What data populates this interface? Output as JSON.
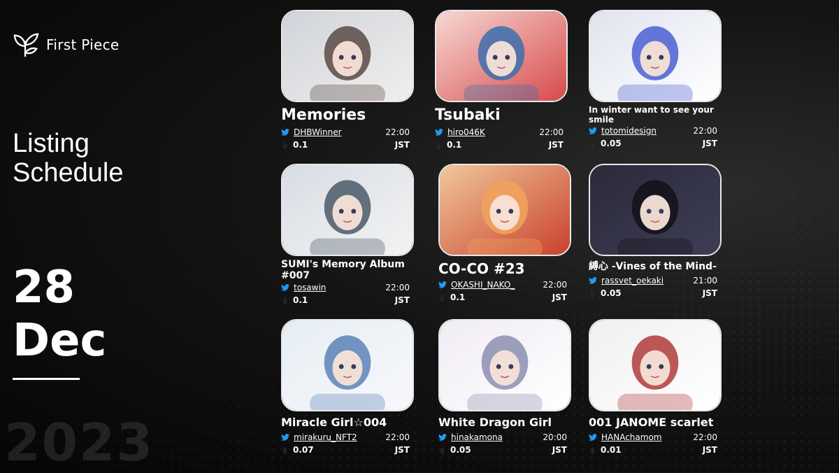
{
  "brand": {
    "name": "First Piece"
  },
  "heading": {
    "line1": "Listing",
    "line2": "Schedule"
  },
  "date": {
    "day": "28",
    "month": "Dec",
    "year": "2023"
  },
  "colors": {
    "background": "#0d0d0d",
    "text": "#ffffff",
    "twitter": "#1d9bf0",
    "frame": "#e9e9e9"
  },
  "cards": [
    {
      "title": "Memories",
      "handle": "DHBWinner",
      "time": "22:00",
      "price": "0.1",
      "timezone": "JST"
    },
    {
      "title": "Tsubaki",
      "handle": "hiro046K",
      "time": "22:00",
      "price": "0.1",
      "timezone": "JST"
    },
    {
      "title": "In winter want to see your smile",
      "handle": "totomidesign",
      "time": "22:00",
      "price": "0.05",
      "timezone": "JST"
    },
    {
      "title": "SUMI's Memory Album #007",
      "handle": "tosawin",
      "time": "22:00",
      "price": "0.1",
      "timezone": "JST"
    },
    {
      "title": "CO-CO #23",
      "handle": "OKASHI_NAKO_",
      "time": "22:00",
      "price": "0.1",
      "timezone": "JST"
    },
    {
      "title": "縛心 -Vines of the Mind-",
      "handle": "rassvet_oekaki",
      "time": "21:00",
      "price": "0.05",
      "timezone": "JST"
    },
    {
      "title": "Miracle Girl☆004",
      "handle": "mirakuru_NFT2",
      "time": "22:00",
      "price": "0.07",
      "timezone": "JST"
    },
    {
      "title": "White Dragon Girl",
      "handle": "hinakamona",
      "time": "20:00",
      "price": "0.05",
      "timezone": "JST"
    },
    {
      "title": "001 JANOME scarlet",
      "handle": "HANAchamom",
      "time": "22:00",
      "price": "0.01",
      "timezone": "JST"
    }
  ]
}
